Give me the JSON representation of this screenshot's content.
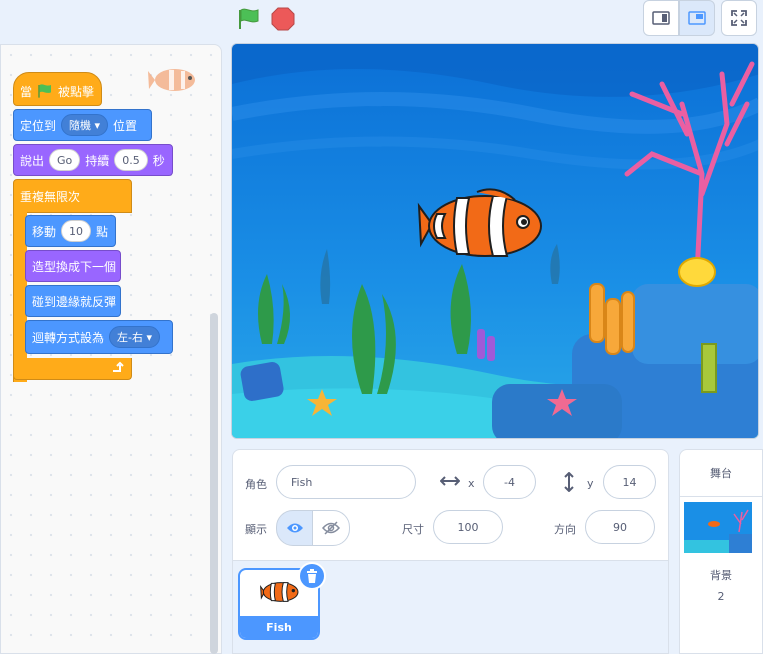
{
  "toolbar": {
    "green_flag_icon": "green-flag-icon",
    "stop_icon": "stop-icon",
    "modes": [
      {
        "icon": "small-stage-icon",
        "active": false
      },
      {
        "icon": "normal-stage-icon",
        "active": true
      },
      {
        "icon": "fullscreen-icon",
        "active": false
      }
    ]
  },
  "code": {
    "hat": {
      "before": "當",
      "after": "被點擊"
    },
    "goto": {
      "label": "定位到",
      "option": "隨機",
      "suffix": "位置"
    },
    "say": {
      "label": "說出",
      "text": "Go",
      "mid": "持續",
      "secs": "0.5",
      "suffix": "秒"
    },
    "forever": "重複無限次",
    "move": {
      "label": "移動",
      "steps": "10",
      "suffix": "點"
    },
    "next_costume": "造型換成下一個",
    "bounce": "碰到邊緣就反彈",
    "rotation": {
      "label": "迴轉方式設為",
      "option": "左-右"
    }
  },
  "sprite_info": {
    "sprite_label": "角色",
    "sprite_name": "Fish",
    "x_label": "x",
    "x_value": "-4",
    "y_label": "y",
    "y_value": "14",
    "show_label": "顯示",
    "size_label": "尺寸",
    "size_value": "100",
    "direction_label": "方向",
    "direction_value": "90"
  },
  "sprites": [
    {
      "name": "Fish",
      "selected": true
    }
  ],
  "stage_pane": {
    "title": "舞台",
    "backdrops_label": "背景",
    "backdrops_count": "2"
  },
  "colors": {
    "motion": "#4c97ff",
    "looks": "#9966ff",
    "events": "#ffab19",
    "stage_water": "#1e88e5"
  }
}
